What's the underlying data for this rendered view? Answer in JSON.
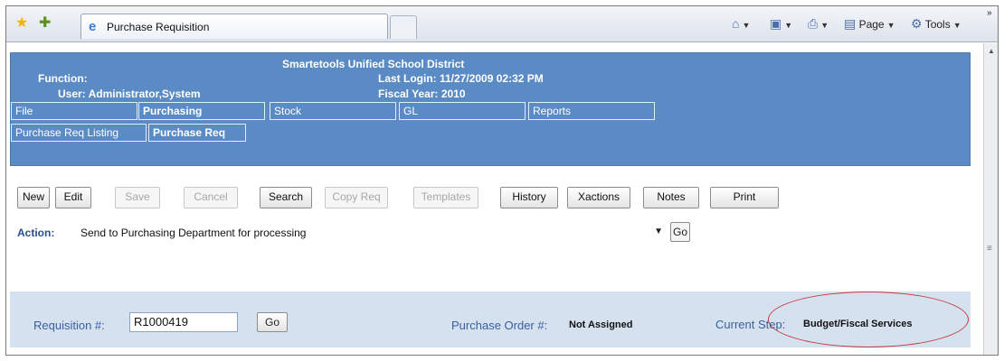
{
  "browser": {
    "tab_title": "Purchase Requisition",
    "toolbar": {
      "page_label": "Page",
      "tools_label": "Tools",
      "overflow": "»"
    }
  },
  "header": {
    "district": "Smartetools Unified School District",
    "function_label": "Function:",
    "user_text": "User: Administrator,System",
    "last_login": "Last Login: 11/27/2009 02:32 PM",
    "fiscal_year": "Fiscal Year: 2010"
  },
  "menu": {
    "row1": [
      "File",
      "Purchasing",
      "Stock",
      "GL",
      "Reports"
    ],
    "row2": [
      "Purchase Req Listing",
      "Purchase Req"
    ]
  },
  "buttons": [
    {
      "label": "New",
      "enabled": true
    },
    {
      "label": "Edit",
      "enabled": true
    },
    {
      "label": "Save",
      "enabled": false
    },
    {
      "label": "Cancel",
      "enabled": false
    },
    {
      "label": "Search",
      "enabled": true
    },
    {
      "label": "Copy Req",
      "enabled": false
    },
    {
      "label": "Templates",
      "enabled": false
    },
    {
      "label": "History",
      "enabled": true
    },
    {
      "label": "Xactions",
      "enabled": true
    },
    {
      "label": "Notes",
      "enabled": true
    },
    {
      "label": "Print",
      "enabled": true
    }
  ],
  "action": {
    "label": "Action:",
    "selected": "Send to Purchasing Department for processing",
    "go": "Go"
  },
  "requisition": {
    "label": "Requisition #:",
    "value": "R1000419",
    "go": "Go",
    "po_label": "Purchase Order #:",
    "po_value": "Not Assigned",
    "step_label": "Current Step:",
    "step_value": "Budget/Fiscal Services"
  },
  "colors": {
    "header_bg": "#5b8bc4",
    "band_bg": "#d6e1f0",
    "annotation_circle": "#c43a3a"
  }
}
